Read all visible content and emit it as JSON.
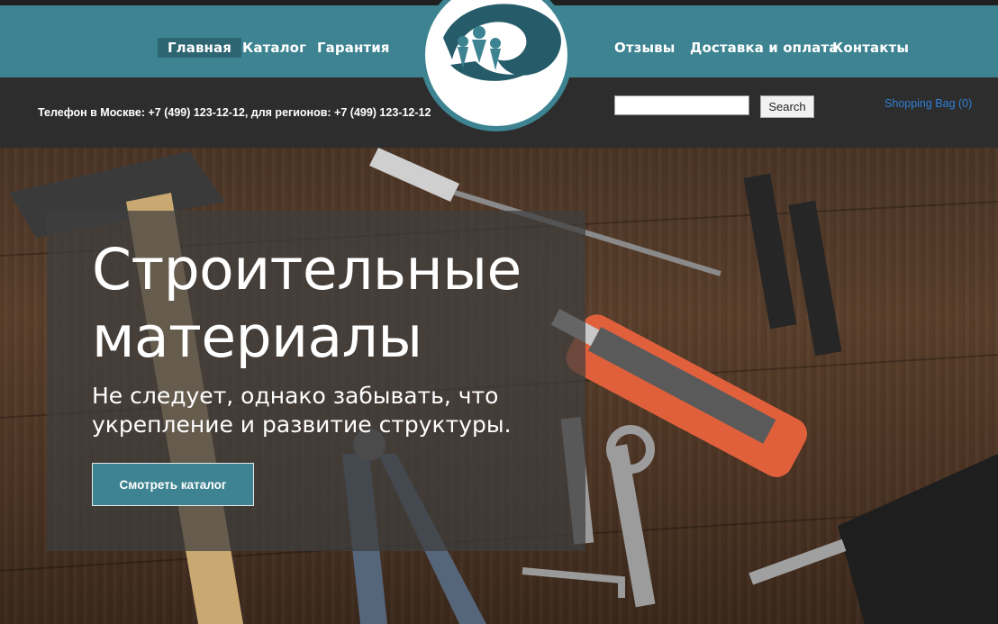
{
  "nav": {
    "left": [
      "Главная",
      "Каталог",
      "Гарантия"
    ],
    "right": [
      "Отзывы",
      "Доставка и оплата",
      "Контакты"
    ],
    "active": "Главная"
  },
  "header": {
    "phone": "Телефон в Москве: +7 (499) 123-12-12, для регионов: +7 (499) 123-12-12",
    "search_value": "",
    "search_button": "Search",
    "bag": "Shopping Bag (0)"
  },
  "hero": {
    "title": "Строительные материалы",
    "subtitle": "Не следует, однако забывать, что укрепление и развитие структуры.",
    "button": "Смотреть каталог"
  },
  "colors": {
    "accent": "#3d8391",
    "dark_bar": "#2d2d2d",
    "logo_dark": "#265c6a",
    "link": "#2f7fd6"
  },
  "icons": {
    "logo": "people-wave-logo-icon"
  }
}
